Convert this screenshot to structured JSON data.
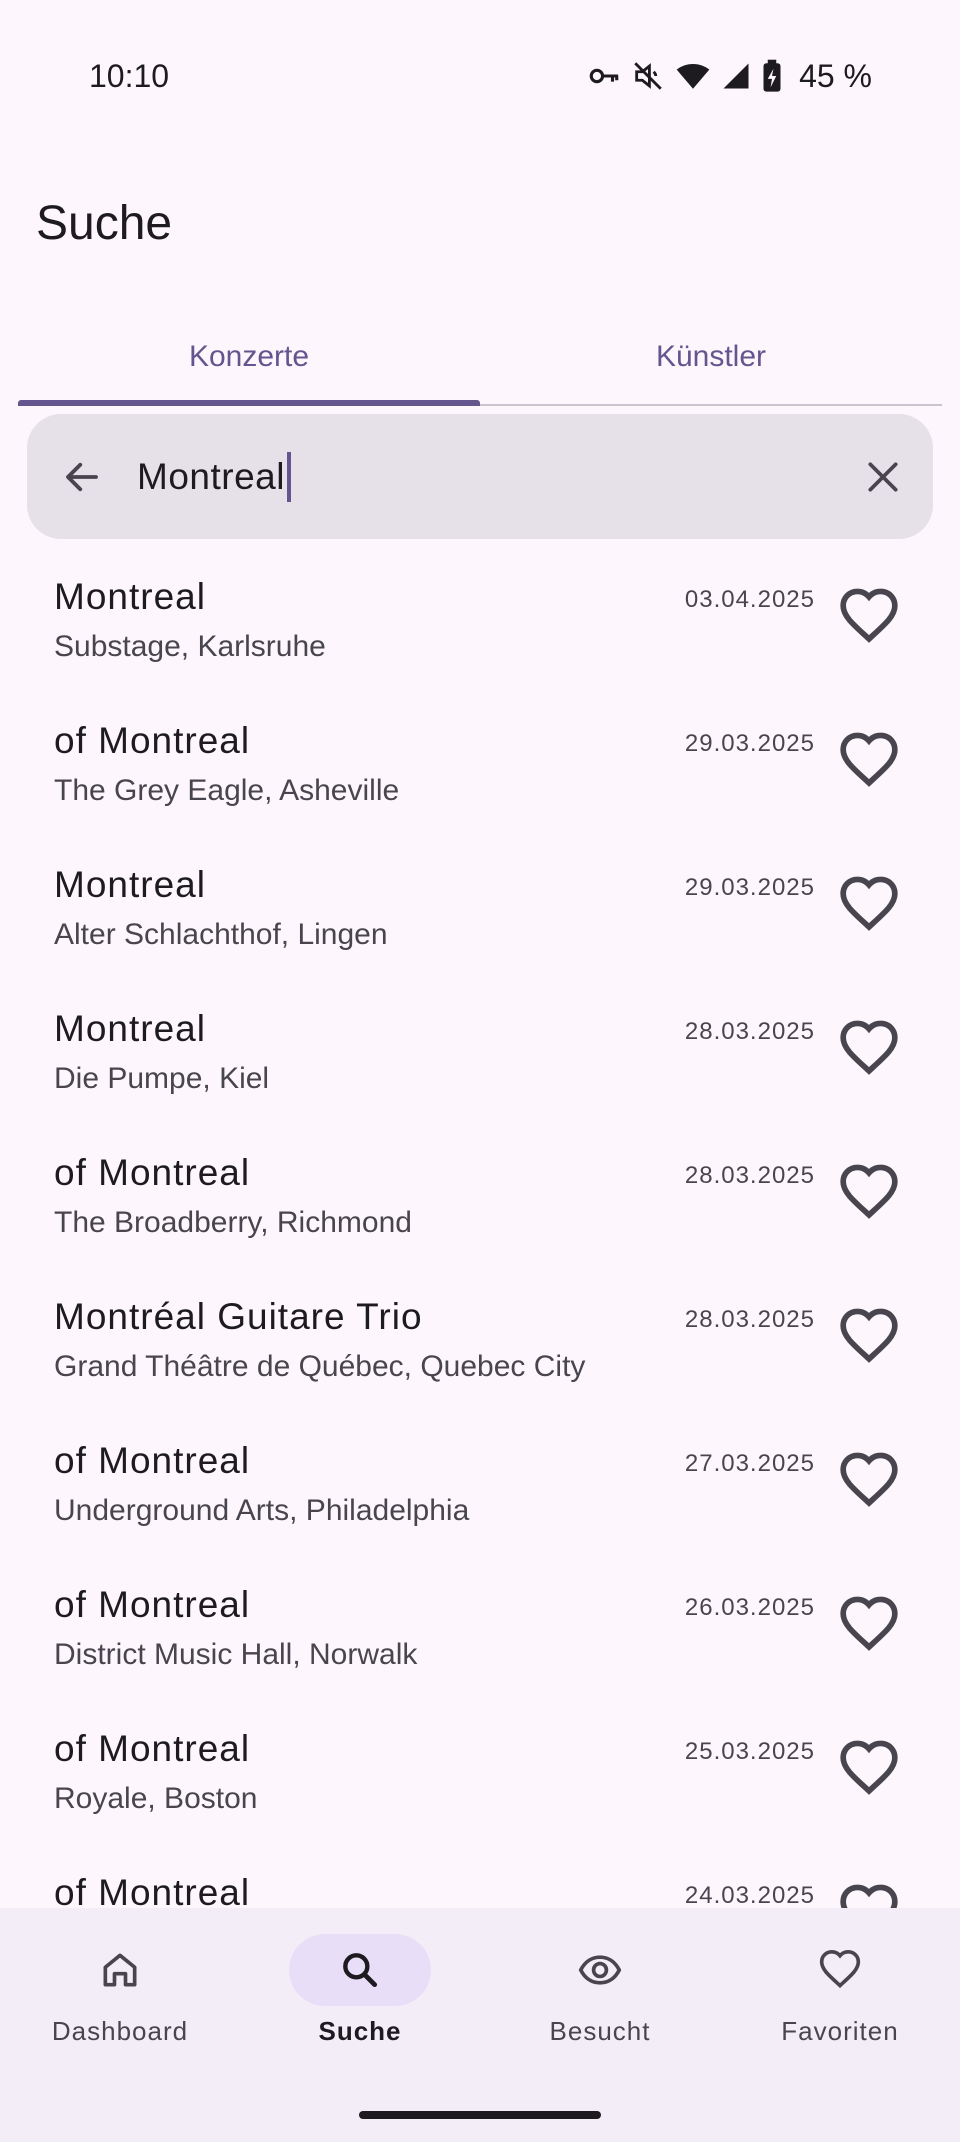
{
  "status_bar": {
    "time": "10:10",
    "battery": "45 %",
    "icons": [
      "vpn-key-icon",
      "mute-icon",
      "wifi-icon",
      "signal-icon",
      "battery-charging-icon"
    ]
  },
  "page": {
    "title": "Suche"
  },
  "tabs": [
    {
      "label": "Konzerte",
      "active": true
    },
    {
      "label": "Künstler",
      "active": false
    }
  ],
  "search": {
    "value": "Montreal",
    "back_icon": "arrow-back-icon",
    "clear_icon": "close-icon"
  },
  "results": [
    {
      "title": "Montreal",
      "venue": "Substage, Karlsruhe",
      "date": "03.04.2025"
    },
    {
      "title": "of Montreal",
      "venue": "The Grey Eagle, Asheville",
      "date": "29.03.2025"
    },
    {
      "title": "Montreal",
      "venue": "Alter Schlachthof, Lingen",
      "date": "29.03.2025"
    },
    {
      "title": "Montreal",
      "venue": "Die Pumpe, Kiel",
      "date": "28.03.2025"
    },
    {
      "title": "of Montreal",
      "venue": "The Broadberry, Richmond",
      "date": "28.03.2025"
    },
    {
      "title": "Montréal Guitare Trio",
      "venue": "Grand Théâtre de Québec, Quebec City",
      "date": "28.03.2025"
    },
    {
      "title": "of Montreal",
      "venue": "Underground Arts, Philadelphia",
      "date": "27.03.2025"
    },
    {
      "title": "of Montreal",
      "venue": "District Music Hall, Norwalk",
      "date": "26.03.2025"
    },
    {
      "title": "of Montreal",
      "venue": "Royale, Boston",
      "date": "25.03.2025"
    },
    {
      "title": "of Montreal",
      "venue": "",
      "date": "24.03.2025"
    }
  ],
  "bottom_nav": [
    {
      "label": "Dashboard",
      "icon": "home-icon",
      "active": false
    },
    {
      "label": "Suche",
      "icon": "search-icon",
      "active": true
    },
    {
      "label": "Besucht",
      "icon": "eye-icon",
      "active": false
    },
    {
      "label": "Favoriten",
      "icon": "heart-icon",
      "active": false
    }
  ],
  "colors": {
    "background": "#fdf7fd",
    "accent": "#65558f",
    "search_field": "#e6e0e9",
    "nav_background": "#f3edf7",
    "nav_active_pill": "#e8def8"
  }
}
